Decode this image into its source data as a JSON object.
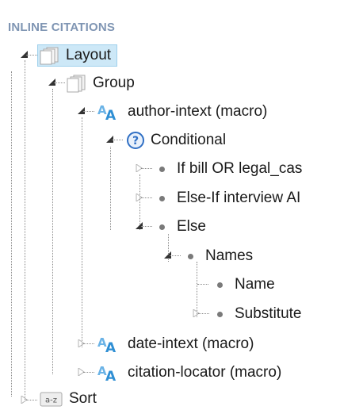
{
  "section_title": "INLINE CITATIONS",
  "tree": {
    "layout": "Layout",
    "group": "Group",
    "author_intext": "author-intext (macro)",
    "conditional": "Conditional",
    "if_branch": "If bill OR legal_cas",
    "else_if_branch": "Else-If interview AI",
    "else_branch": "Else",
    "names": "Names",
    "name": "Name",
    "substitute": "Substitute",
    "date_intext": "date-intext (macro)",
    "citation_locator": "citation-locator (macro)",
    "sort": "Sort"
  },
  "colors": {
    "selected_bg": "#cde8f7",
    "macro_icon": "#2f8fd4",
    "help_icon": "#2f6fc4",
    "section_title": "#7f95b3"
  },
  "icons": {
    "page": "page-stack-icon",
    "macro": "macro-ab-icon",
    "conditional": "question-circle-icon",
    "sort": "sort-az-icon"
  }
}
